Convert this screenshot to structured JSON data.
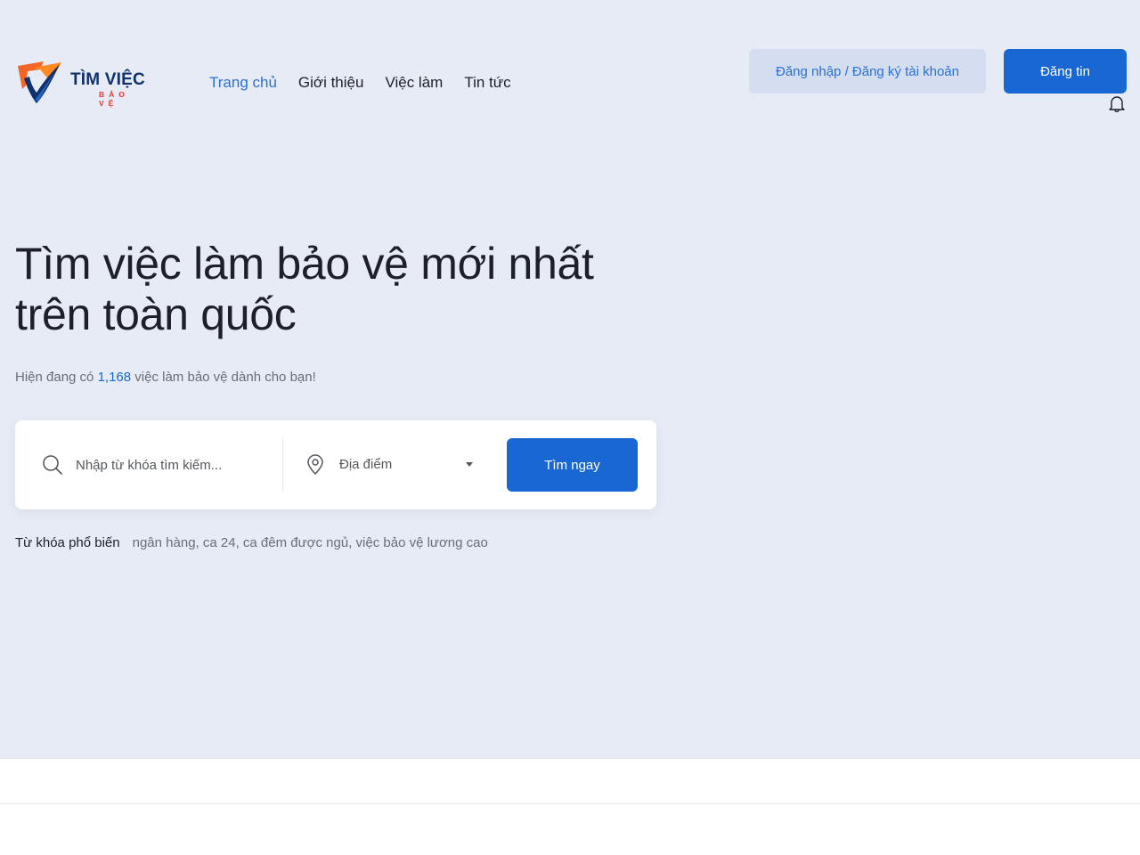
{
  "header": {
    "logo": {
      "title": "TÌM VIỆC",
      "subtitle": "BẢO VỆ"
    },
    "nav": [
      {
        "label": "Trang chủ",
        "active": true
      },
      {
        "label": "Giới thiệu",
        "active": false
      },
      {
        "label": "Việc làm",
        "active": false
      },
      {
        "label": "Tin tức",
        "active": false
      }
    ],
    "login_label": "Đăng nhập / Đăng ký tài khoản",
    "post_label": "Đăng tin",
    "notification_icon": "bell-icon"
  },
  "hero": {
    "title": "Tìm việc làm bảo vệ mới nhất trên toàn quốc",
    "subtitle_prefix": "Hiện đang có ",
    "job_count": "1,168",
    "subtitle_suffix": " việc làm bảo vệ dành cho bạn!"
  },
  "search": {
    "keyword_placeholder": "Nhập từ khóa tìm kiếm...",
    "keyword_value": "",
    "location_label": "Địa điểm",
    "submit_label": "Tìm ngay"
  },
  "popular_keywords": {
    "label": "Từ khóa phổ biến",
    "items": [
      "ngân hàng,",
      "ca 24,",
      "ca đêm được ngủ,",
      "việc bảo vệ lương cao"
    ]
  },
  "colors": {
    "hero_background": "#e6ebf5",
    "primary": "#1967d2",
    "nav_active": "#2a6fd6",
    "login_button_bg": "#d4def0",
    "logo_navy": "#10316b",
    "logo_red": "#e53935",
    "logo_orange": "#f26522"
  }
}
